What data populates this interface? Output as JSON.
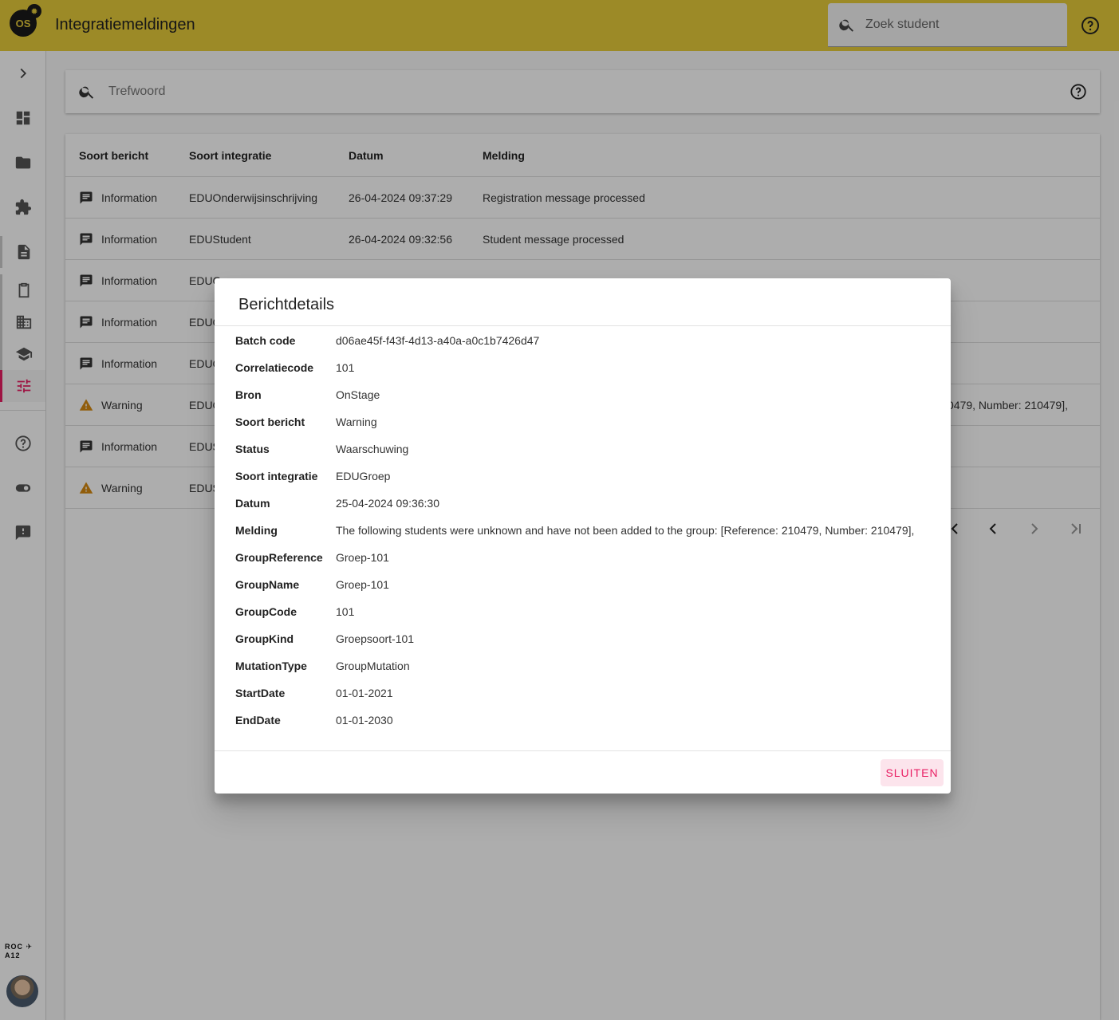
{
  "header": {
    "logo_text": "OS",
    "title": "Integratiemeldingen",
    "search_placeholder": "Zoek student",
    "help_icon": "help-circle-icon"
  },
  "sidebar": {
    "items": [
      {
        "icon": "chevron-right-icon"
      },
      {
        "icon": "dashboard-icon"
      },
      {
        "icon": "folder-icon"
      },
      {
        "icon": "puzzle-icon"
      },
      {
        "icon": "document-icon"
      },
      {
        "icon": "clipboard-icon"
      },
      {
        "icon": "building-icon"
      },
      {
        "icon": "school-icon"
      },
      {
        "icon": "tune-icon",
        "active": true
      },
      {
        "icon": "help-circle-icon"
      },
      {
        "icon": "toggle-icon"
      },
      {
        "icon": "feedback-icon"
      }
    ],
    "org_logo": "ROC A12",
    "accent_color": "#e91e63"
  },
  "filter": {
    "placeholder": "Trefwoord"
  },
  "table": {
    "columns": [
      "Soort bericht",
      "Soort integratie",
      "Datum",
      "Melding"
    ],
    "rows": [
      {
        "type": "Information",
        "integration": "EDUOnderwijsinschrijving",
        "date": "26-04-2024 09:37:29",
        "message": "Registration message processed"
      },
      {
        "type": "Information",
        "integration": "EDUStudent",
        "date": "26-04-2024 09:32:56",
        "message": "Student message processed"
      },
      {
        "type": "Information",
        "integration": "EDUG",
        "date": "",
        "message": ""
      },
      {
        "type": "Information",
        "integration": "EDUG",
        "date": "",
        "message": ""
      },
      {
        "type": "Information",
        "integration": "EDUG",
        "date": "",
        "message": ""
      },
      {
        "type": "Warning",
        "integration": "EDUG",
        "date": "",
        "message": "0479, Number: 210479],"
      },
      {
        "type": "Information",
        "integration": "EDUS",
        "date": "",
        "message": ""
      },
      {
        "type": "Warning",
        "integration": "EDUS",
        "date": "",
        "message": ""
      }
    ]
  },
  "dialog": {
    "title": "Berichtdetails",
    "fields": [
      {
        "label": "Batch code",
        "value": "d06ae45f-f43f-4d13-a40a-a0c1b7426d47"
      },
      {
        "label": "Correlatiecode",
        "value": "101"
      },
      {
        "label": "Bron",
        "value": "OnStage"
      },
      {
        "label": "Soort bericht",
        "value": "Warning"
      },
      {
        "label": "Status",
        "value": "Waarschuwing"
      },
      {
        "label": "Soort integratie",
        "value": "EDUGroep"
      },
      {
        "label": "Datum",
        "value": "25-04-2024 09:36:30"
      },
      {
        "label": "Melding",
        "value": "The following students were unknown and have not been added to the group: [Reference: 210479, Number: 210479],"
      },
      {
        "label": "GroupReference",
        "value": "Groep-101"
      },
      {
        "label": "GroupName",
        "value": "Groep-101"
      },
      {
        "label": "GroupCode",
        "value": "101"
      },
      {
        "label": "GroupKind",
        "value": "Groepsoort-101"
      },
      {
        "label": "MutationType",
        "value": "GroupMutation"
      },
      {
        "label": "StartDate",
        "value": "01-01-2021"
      },
      {
        "label": "EndDate",
        "value": "01-01-2030"
      }
    ],
    "close_label": "SLUITEN"
  },
  "colors": {
    "topbar": "#e6cc3a",
    "accent": "#e91e63",
    "warning": "#f39c12"
  }
}
